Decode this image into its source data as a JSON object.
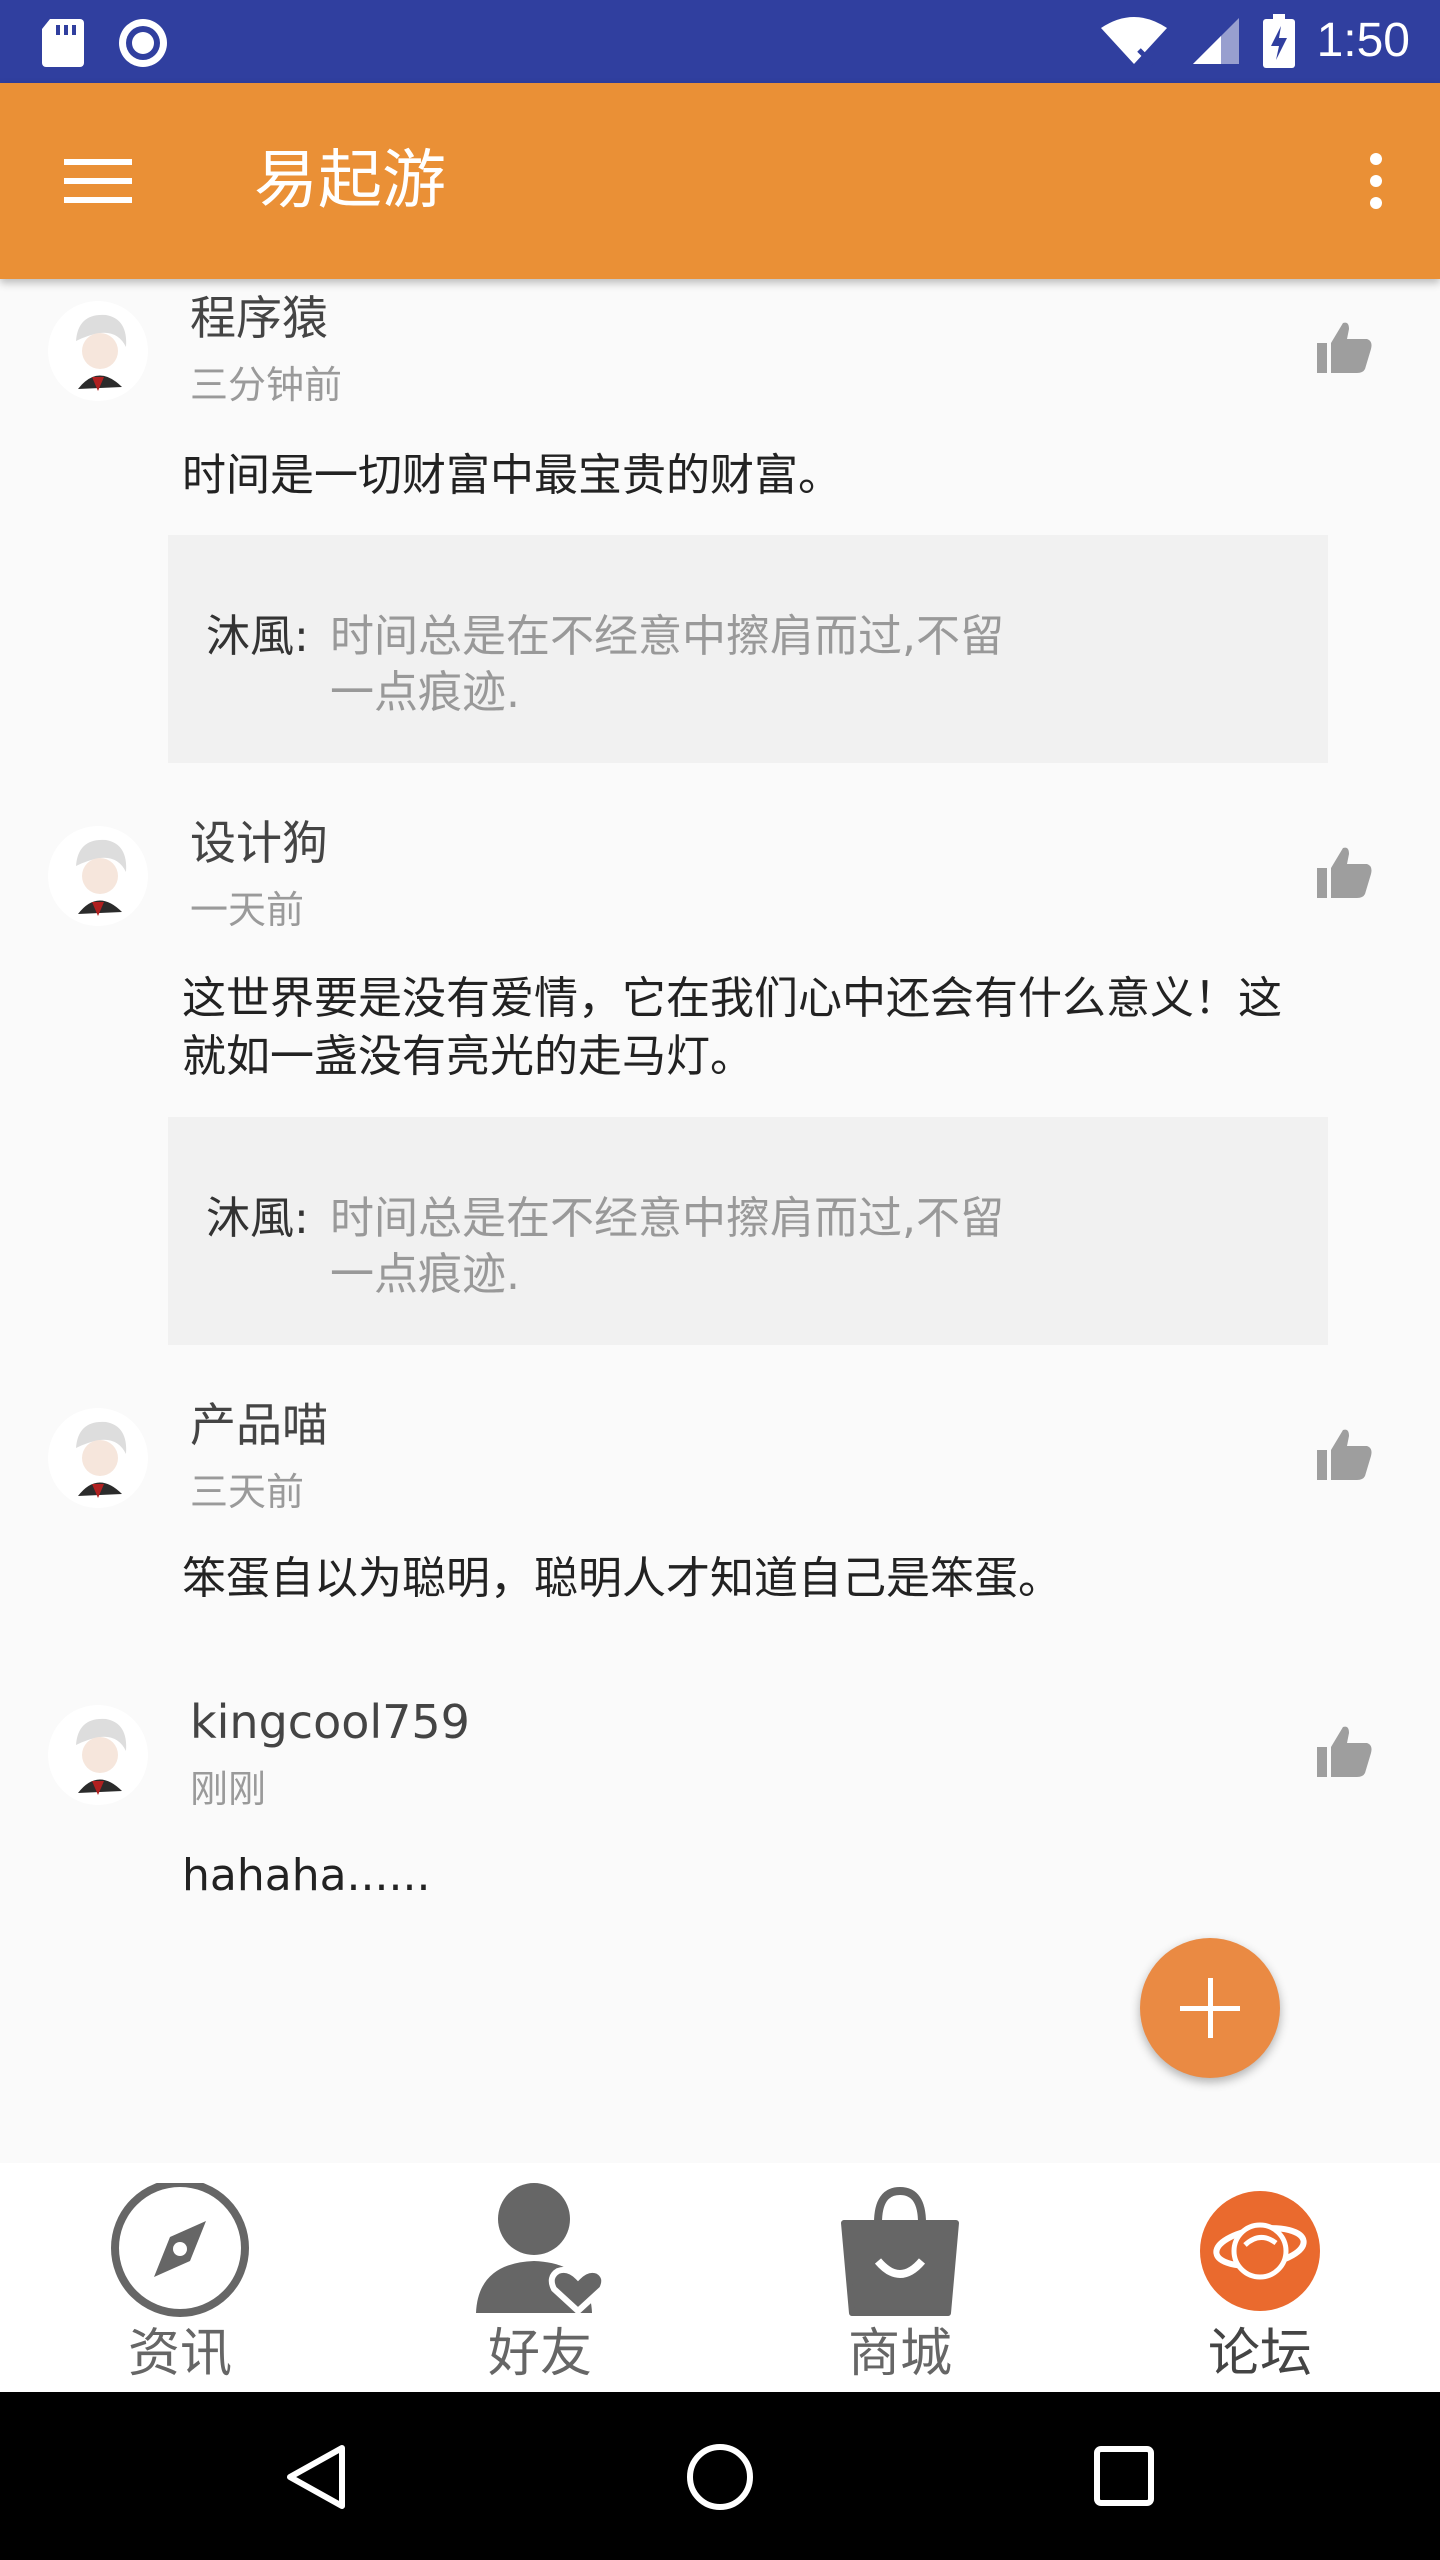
{
  "status_bar": {
    "time": "1:50",
    "icons": [
      "sd-card-icon",
      "record-icon",
      "wifi-icon",
      "signal-icon",
      "battery-charging-icon"
    ]
  },
  "app_bar": {
    "title": "易起游",
    "menu_icon": "hamburger-menu-icon",
    "more_icon": "overflow-menu-icon"
  },
  "comments": [
    {
      "name": "程序猿",
      "time": "三分钟前",
      "text": "时间是一切财富中最宝贵的财富。",
      "reply": {
        "name": "沐風:",
        "text": "时间总是在不经意中擦肩而过,不留一点痕迹."
      }
    },
    {
      "name": "设计狗",
      "time": "一天前",
      "text": "这世界要是没有爱情，它在我们心中还会有什么意义！这就如一盏没有亮光的走马灯。",
      "reply": {
        "name": "沐風:",
        "text": "时间总是在不经意中擦肩而过,不留一点痕迹."
      }
    },
    {
      "name": "产品喵",
      "time": "三天前",
      "text": "笨蛋自以为聪明，聪明人才知道自己是笨蛋。"
    },
    {
      "name": "kingcool759",
      "time": "刚刚",
      "text": "hahaha......"
    }
  ],
  "fab": {
    "icon": "plus-icon"
  },
  "bottom_nav": {
    "items": [
      {
        "label": "资讯",
        "icon": "compass-icon"
      },
      {
        "label": "好友",
        "icon": "friends-icon"
      },
      {
        "label": "商城",
        "icon": "shopping-bag-icon"
      },
      {
        "label": "论坛",
        "icon": "planet-icon",
        "active": true
      }
    ],
    "active_color": "#ea6a2e"
  },
  "colors": {
    "status_bar": "#303f9f",
    "app_bar": "#ea9036",
    "fab": "#ea8a43"
  }
}
